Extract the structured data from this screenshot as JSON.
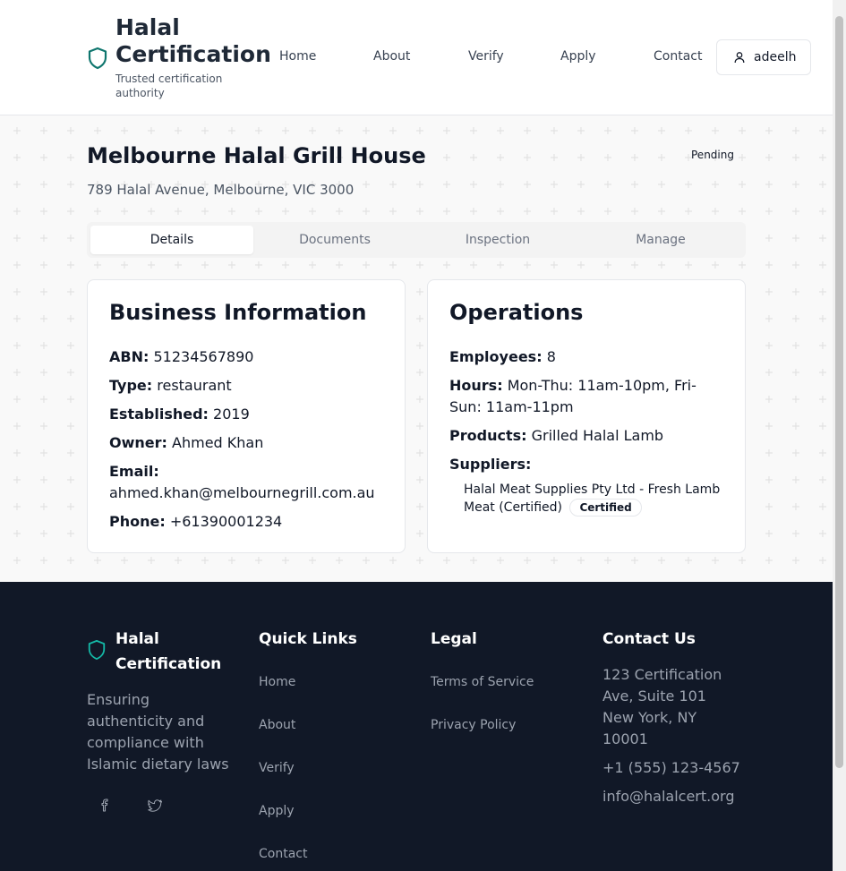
{
  "header": {
    "brand_title": "Halal Certification",
    "brand_subtitle": "Trusted certification authority",
    "nav": [
      "Home",
      "About",
      "Verify",
      "Apply",
      "Contact"
    ],
    "user_name": "adeelh",
    "brand_color": "#0f766e"
  },
  "business": {
    "name": "Melbourne Halal Grill House",
    "address": "789 Halal Avenue, Melbourne, VIC 3000",
    "status": "Pending"
  },
  "tabs": [
    "Details",
    "Documents",
    "Inspection",
    "Manage"
  ],
  "active_tab": "Details",
  "business_info": {
    "title": "Business Information",
    "abn_label": "ABN:",
    "abn": "51234567890",
    "type_label": "Type:",
    "type": "restaurant",
    "established_label": "Established:",
    "established": "2019",
    "owner_label": "Owner:",
    "owner": "Ahmed Khan",
    "email_label": "Email:",
    "email": "ahmed.khan@melbournegrill.com.au",
    "phone_label": "Phone:",
    "phone": "+61390001234"
  },
  "operations": {
    "title": "Operations",
    "employees_label": "Employees:",
    "employees": "8",
    "hours_label": "Hours:",
    "hours": "Mon-Thu: 11am-10pm, Fri-Sun: 11am-11pm",
    "products_label": "Products:",
    "products": "Grilled Halal Lamb",
    "suppliers_label": "Suppliers:",
    "suppliers": [
      {
        "text": "Halal Meat Supplies Pty Ltd - Fresh Lamb Meat (Certified)",
        "badge": "Certified"
      }
    ]
  },
  "footer": {
    "brand_title": "Halal Certification",
    "tagline": "Ensuring authenticity and compliance with Islamic dietary laws",
    "quick_links_heading": "Quick Links",
    "quick_links": [
      "Home",
      "About",
      "Verify",
      "Apply",
      "Contact"
    ],
    "legal_heading": "Legal",
    "legal_links": [
      "Terms of Service",
      "Privacy Policy"
    ],
    "contact_heading": "Contact Us",
    "contact_address": "123 Certification Ave, Suite 101 New York, NY 10001",
    "contact_phone": "+1 (555) 123-4567",
    "contact_email": "info@halalcert.org",
    "social_icons": [
      "facebook-icon",
      "twitter-icon"
    ]
  }
}
